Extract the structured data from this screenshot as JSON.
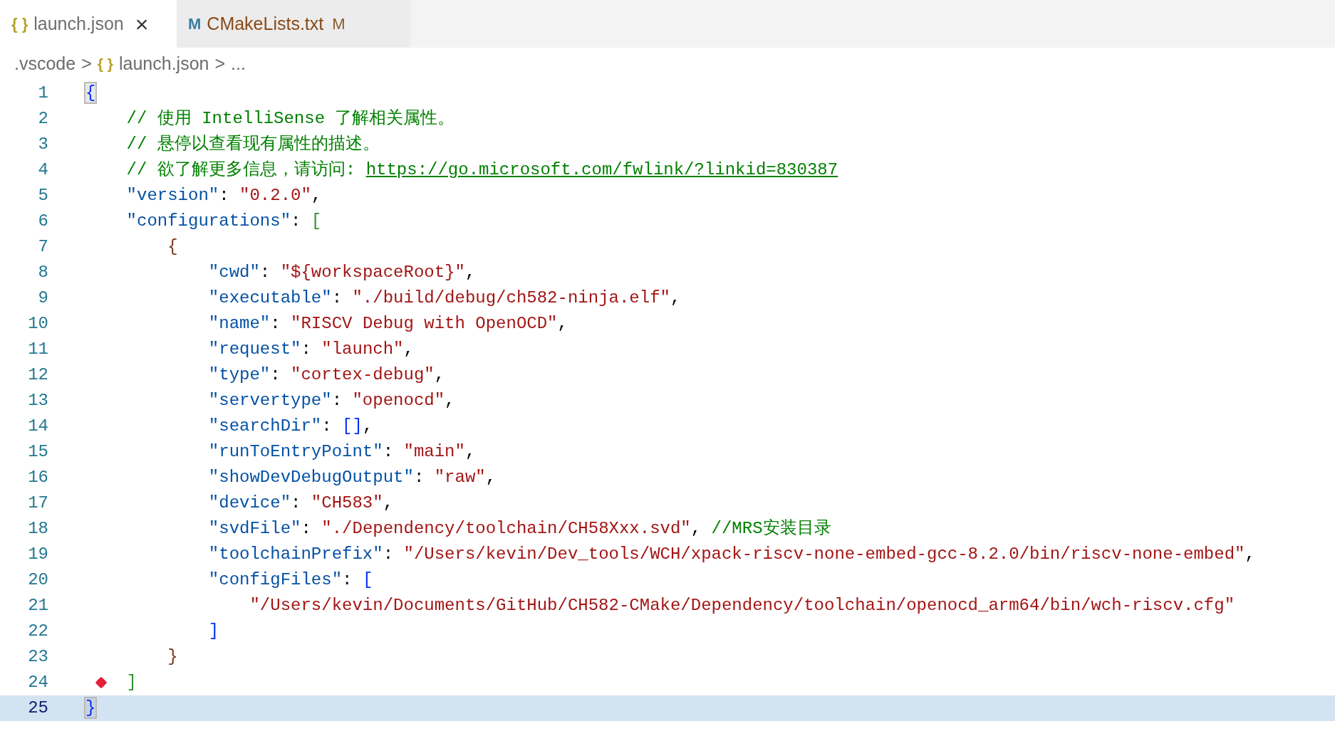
{
  "tabs": [
    {
      "icon": "{ }",
      "color": "#b5a22a",
      "label": "launch.json",
      "selected": true,
      "close": "×"
    },
    {
      "icon": "M",
      "color": "#3b7ea1",
      "label": "CMakeLists.txt",
      "selected": false,
      "modified": "M"
    }
  ],
  "breadcrumb": {
    "folder": ".vscode",
    "separator_1": ">",
    "icon": "{ }",
    "file": "launch.json",
    "separator_2": ">",
    "more": "..."
  },
  "lines": [
    {
      "number": "1",
      "current": false,
      "marker": false,
      "tokens": [
        {
          "kind": "bracket",
          "text": "{",
          "color": "#0431fa",
          "matched": true
        }
      ]
    },
    {
      "number": "2",
      "current": false,
      "marker": false,
      "tokens": [
        {
          "kind": "comment",
          "text": "    // 使用 IntelliSense 了解相关属性。"
        }
      ]
    },
    {
      "number": "3",
      "current": false,
      "marker": false,
      "tokens": [
        {
          "kind": "comment",
          "text": "    // 悬停以查看现有属性的描述。"
        }
      ]
    },
    {
      "number": "4",
      "current": false,
      "marker": false,
      "tokens": [
        {
          "kind": "comment",
          "text": "    // 欲了解更多信息，请访问: "
        },
        {
          "kind": "link",
          "text": "https://go.microsoft.com/fwlink/?linkid=830387"
        }
      ]
    },
    {
      "number": "5",
      "current": false,
      "marker": false,
      "tokens": [
        {
          "kind": "key",
          "text": "    \"version\""
        },
        {
          "kind": "punct",
          "text": ": "
        },
        {
          "kind": "string",
          "text": "\"0.2.0\""
        },
        {
          "kind": "punct",
          "text": ","
        }
      ]
    },
    {
      "number": "6",
      "current": false,
      "marker": false,
      "tokens": [
        {
          "kind": "key",
          "text": "    \"configurations\""
        },
        {
          "kind": "punct",
          "text": ": "
        },
        {
          "kind": "bracket",
          "text": "[",
          "color": "#319331",
          "matched": false
        }
      ]
    },
    {
      "number": "7",
      "current": false,
      "marker": false,
      "tokens": [
        {
          "kind": "bracket",
          "text": "        {",
          "color": "#7b3814",
          "matched": false
        }
      ]
    },
    {
      "number": "8",
      "current": false,
      "marker": false,
      "tokens": [
        {
          "kind": "key",
          "text": "            \"cwd\""
        },
        {
          "kind": "punct",
          "text": ": "
        },
        {
          "kind": "string",
          "text": "\"${workspaceRoot}\""
        },
        {
          "kind": "punct",
          "text": ","
        }
      ]
    },
    {
      "number": "9",
      "current": false,
      "marker": false,
      "tokens": [
        {
          "kind": "key",
          "text": "            \"executable\""
        },
        {
          "kind": "punct",
          "text": ": "
        },
        {
          "kind": "string",
          "text": "\"./build/debug/ch582-ninja.elf\""
        },
        {
          "kind": "punct",
          "text": ","
        }
      ]
    },
    {
      "number": "10",
      "current": false,
      "marker": false,
      "tokens": [
        {
          "kind": "key",
          "text": "            \"name\""
        },
        {
          "kind": "punct",
          "text": ": "
        },
        {
          "kind": "string",
          "text": "\"RISCV Debug with OpenOCD\""
        },
        {
          "kind": "punct",
          "text": ","
        }
      ]
    },
    {
      "number": "11",
      "current": false,
      "marker": false,
      "tokens": [
        {
          "kind": "key",
          "text": "            \"request\""
        },
        {
          "kind": "punct",
          "text": ": "
        },
        {
          "kind": "string",
          "text": "\"launch\""
        },
        {
          "kind": "punct",
          "text": ","
        }
      ]
    },
    {
      "number": "12",
      "current": false,
      "marker": false,
      "tokens": [
        {
          "kind": "key",
          "text": "            \"type\""
        },
        {
          "kind": "punct",
          "text": ": "
        },
        {
          "kind": "string",
          "text": "\"cortex-debug\""
        },
        {
          "kind": "punct",
          "text": ","
        }
      ]
    },
    {
      "number": "13",
      "current": false,
      "marker": false,
      "tokens": [
        {
          "kind": "key",
          "text": "            \"servertype\""
        },
        {
          "kind": "punct",
          "text": ": "
        },
        {
          "kind": "string",
          "text": "\"openocd\""
        },
        {
          "kind": "punct",
          "text": ","
        }
      ]
    },
    {
      "number": "14",
      "current": false,
      "marker": false,
      "tokens": [
        {
          "kind": "key",
          "text": "            \"searchDir\""
        },
        {
          "kind": "punct",
          "text": ": "
        },
        {
          "kind": "bracket",
          "text": "[]",
          "color": "#0431fa",
          "matched": false
        },
        {
          "kind": "punct",
          "text": ","
        }
      ]
    },
    {
      "number": "15",
      "current": false,
      "marker": false,
      "tokens": [
        {
          "kind": "key",
          "text": "            \"runToEntryPoint\""
        },
        {
          "kind": "punct",
          "text": ": "
        },
        {
          "kind": "string",
          "text": "\"main\""
        },
        {
          "kind": "punct",
          "text": ","
        }
      ]
    },
    {
      "number": "16",
      "current": false,
      "marker": false,
      "tokens": [
        {
          "kind": "key",
          "text": "            \"showDevDebugOutput\""
        },
        {
          "kind": "punct",
          "text": ": "
        },
        {
          "kind": "string",
          "text": "\"raw\""
        },
        {
          "kind": "punct",
          "text": ","
        }
      ]
    },
    {
      "number": "17",
      "current": false,
      "marker": false,
      "tokens": [
        {
          "kind": "key",
          "text": "            \"device\""
        },
        {
          "kind": "punct",
          "text": ": "
        },
        {
          "kind": "string",
          "text": "\"CH583\""
        },
        {
          "kind": "punct",
          "text": ","
        }
      ]
    },
    {
      "number": "18",
      "current": false,
      "marker": false,
      "tokens": [
        {
          "kind": "key",
          "text": "            \"svdFile\""
        },
        {
          "kind": "punct",
          "text": ": "
        },
        {
          "kind": "string",
          "text": "\"./Dependency/toolchain/CH58Xxx.svd\""
        },
        {
          "kind": "punct",
          "text": ", "
        },
        {
          "kind": "comment",
          "text": "//MRS安装目录"
        }
      ]
    },
    {
      "number": "19",
      "current": false,
      "marker": false,
      "tokens": [
        {
          "kind": "key",
          "text": "            \"toolchainPrefix\""
        },
        {
          "kind": "punct",
          "text": ": "
        },
        {
          "kind": "string",
          "text": "\"/Users/kevin/Dev_tools/WCH/xpack-riscv-none-embed-gcc-8.2.0/bin/riscv-none-embed\""
        },
        {
          "kind": "punct",
          "text": ","
        }
      ]
    },
    {
      "number": "20",
      "current": false,
      "marker": false,
      "tokens": [
        {
          "kind": "key",
          "text": "            \"configFiles\""
        },
        {
          "kind": "punct",
          "text": ": "
        },
        {
          "kind": "bracket",
          "text": "[",
          "color": "#0431fa",
          "matched": false
        }
      ]
    },
    {
      "number": "21",
      "current": false,
      "marker": false,
      "tokens": [
        {
          "kind": "string",
          "text": "                \"/Users/kevin/Documents/GitHub/CH582-CMake/Dependency/toolchain/openocd_arm64/bin/wch-riscv.cfg\""
        }
      ]
    },
    {
      "number": "22",
      "current": false,
      "marker": false,
      "tokens": [
        {
          "kind": "bracket",
          "text": "            ]",
          "color": "#0431fa",
          "matched": false
        }
      ]
    },
    {
      "number": "23",
      "current": false,
      "marker": false,
      "tokens": [
        {
          "kind": "bracket",
          "text": "        }",
          "color": "#7b3814",
          "matched": false
        }
      ]
    },
    {
      "number": "24",
      "current": false,
      "marker": true,
      "tokens": [
        {
          "kind": "bracket",
          "text": "    ]",
          "color": "#319331",
          "matched": false
        }
      ]
    },
    {
      "number": "25",
      "current": true,
      "marker": false,
      "tokens": [
        {
          "kind": "bracket",
          "text": "}",
          "color": "#0431fa",
          "matched": true
        }
      ]
    }
  ]
}
